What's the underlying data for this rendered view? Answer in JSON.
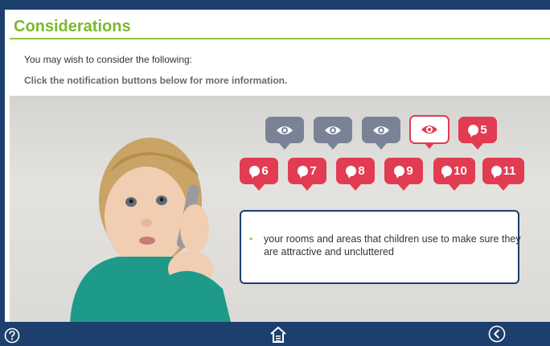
{
  "page": {
    "title": "Considerations"
  },
  "intro_text": "You may wish to consider the following:",
  "instruction_text": "Click the notification buttons below for more information.",
  "buttons_row1": [
    {
      "kind": "eye",
      "state": "visited"
    },
    {
      "kind": "eye",
      "state": "visited"
    },
    {
      "kind": "eye",
      "state": "visited"
    },
    {
      "kind": "eye",
      "state": "selected"
    },
    {
      "kind": "number",
      "label": "5",
      "state": "unvisited"
    }
  ],
  "buttons_row2": [
    {
      "kind": "number",
      "label": "6",
      "state": "unvisited"
    },
    {
      "kind": "number",
      "label": "7",
      "state": "unvisited"
    },
    {
      "kind": "number",
      "label": "8",
      "state": "unvisited"
    },
    {
      "kind": "number",
      "label": "9",
      "state": "unvisited"
    },
    {
      "kind": "number",
      "label": "10",
      "state": "unvisited"
    },
    {
      "kind": "number",
      "label": "11",
      "state": "unvisited"
    }
  ],
  "info_box": {
    "text": "your rooms and areas that children use to make sure they are attractive and uncluttered"
  },
  "footer": {
    "help_icon": "help-icon",
    "home_icon": "home-icon",
    "back_icon": "back-icon"
  },
  "colors": {
    "brand_navy": "#1d3f6e",
    "accent_green": "#7cb82f",
    "notification_red": "#e23c52",
    "visited_grey": "#7a8396"
  }
}
